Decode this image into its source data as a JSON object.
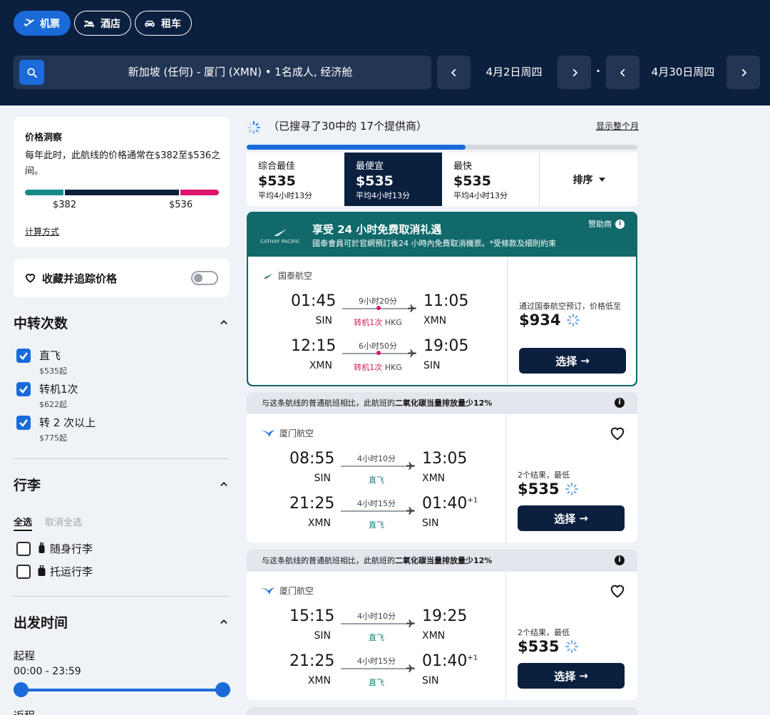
{
  "colors": {
    "navy": "#0b1f3f",
    "accent": "#1a6bd9",
    "teal": "#11696a",
    "pink": "#e0156d"
  },
  "header": {
    "tabs": [
      {
        "label": "机票",
        "icon": "plane-icon",
        "active": true
      },
      {
        "label": "酒店",
        "icon": "bed-icon",
        "active": false
      },
      {
        "label": "租车",
        "icon": "car-icon",
        "active": false
      }
    ],
    "search_summary": "新加坡 (任何) - 厦门 (XMN) • 1名成人, 经济舱",
    "depart_date": "4月2日周四",
    "return_date": "4月30日周四"
  },
  "sidebar": {
    "insight": {
      "title": "价格洞察",
      "text": "每年此时，此航线的价格通常在$382至$536之间。",
      "low": "$382",
      "high": "$536",
      "link": "计算方式"
    },
    "track": {
      "label": "收藏并追踪价格"
    },
    "stops": {
      "title": "中转次数",
      "options": [
        {
          "label": "直飞",
          "sub": "$535起",
          "checked": true
        },
        {
          "label": "转机1次",
          "sub": "$622起",
          "checked": true
        },
        {
          "label": "转 2 次以上",
          "sub": "$775起",
          "checked": true
        }
      ]
    },
    "baggage": {
      "title": "行李",
      "select_all": "全选",
      "deselect_all": "取消全选",
      "options": [
        {
          "label": "随身行李",
          "checked": false
        },
        {
          "label": "托运行李",
          "checked": false
        }
      ]
    },
    "times": {
      "title": "出发时间",
      "outbound_label": "起程",
      "outbound_range": "00:00 - 23:59",
      "return_label": "返程"
    }
  },
  "results": {
    "searched": "（已搜寻了30中的 17个提供商）",
    "progress": 0.56,
    "show_month": "显示整个月",
    "sort_tabs": [
      {
        "name": "综合最佳",
        "price": "$535",
        "sub": "平均4小时13分",
        "active": false
      },
      {
        "name": "最便宜",
        "price": "$535",
        "sub": "平均4小时13分",
        "active": true
      },
      {
        "name": "最快",
        "price": "$535",
        "sub": "平均4小时13分",
        "active": false
      }
    ],
    "sort_label": "排序",
    "sponsored": {
      "logo_text": "CATHAY PACIFIC",
      "title": "享受 24 小时免费取消礼遇",
      "text": "國泰會員可於官網預訂後24 小時內免費取消機票。*受條款及細則約束",
      "tag": "赞助商",
      "airline": "国泰航空",
      "legs": [
        {
          "dep_time": "01:45",
          "dep_code": "SIN",
          "duration": "9小时20分",
          "stops": "转机1次",
          "via": "HKG",
          "arr_time": "11:05",
          "arr_code": "XMN",
          "plus": ""
        },
        {
          "dep_time": "12:15",
          "dep_code": "XMN",
          "duration": "6小时50分",
          "stops": "转机1次",
          "via": "HKG",
          "arr_time": "19:05",
          "arr_code": "SIN",
          "plus": ""
        }
      ],
      "note": "通过国泰航空预订，价格低至",
      "price": "$934",
      "select": "选择"
    },
    "cards": [
      {
        "banner_pre": "与这条航线的普通航班相比，此航班的",
        "banner_bold": "二氧化碳当量排放量少12%",
        "airline": "厦门航空",
        "legs": [
          {
            "dep_time": "08:55",
            "dep_code": "SIN",
            "duration": "4小时10分",
            "stops": "直飞",
            "arr_time": "13:05",
            "arr_code": "XMN",
            "plus": ""
          },
          {
            "dep_time": "21:25",
            "dep_code": "XMN",
            "duration": "4小时15分",
            "stops": "直飞",
            "arr_time": "01:40",
            "arr_code": "SIN",
            "plus": "+1"
          }
        ],
        "note": "2个结果，最低",
        "price": "$535",
        "select": "选择"
      },
      {
        "banner_pre": "与这条航线的普通航班相比，此航班的",
        "banner_bold": "二氧化碳当量排放量少12%",
        "airline": "厦门航空",
        "legs": [
          {
            "dep_time": "15:15",
            "dep_code": "SIN",
            "duration": "4小时10分",
            "stops": "直飞",
            "arr_time": "19:25",
            "arr_code": "XMN",
            "plus": ""
          },
          {
            "dep_time": "21:25",
            "dep_code": "XMN",
            "duration": "4小时15分",
            "stops": "直飞",
            "arr_time": "01:40",
            "arr_code": "SIN",
            "plus": "+1"
          }
        ],
        "note": "2个结果，最低",
        "price": "$535",
        "select": "选择"
      }
    ]
  }
}
